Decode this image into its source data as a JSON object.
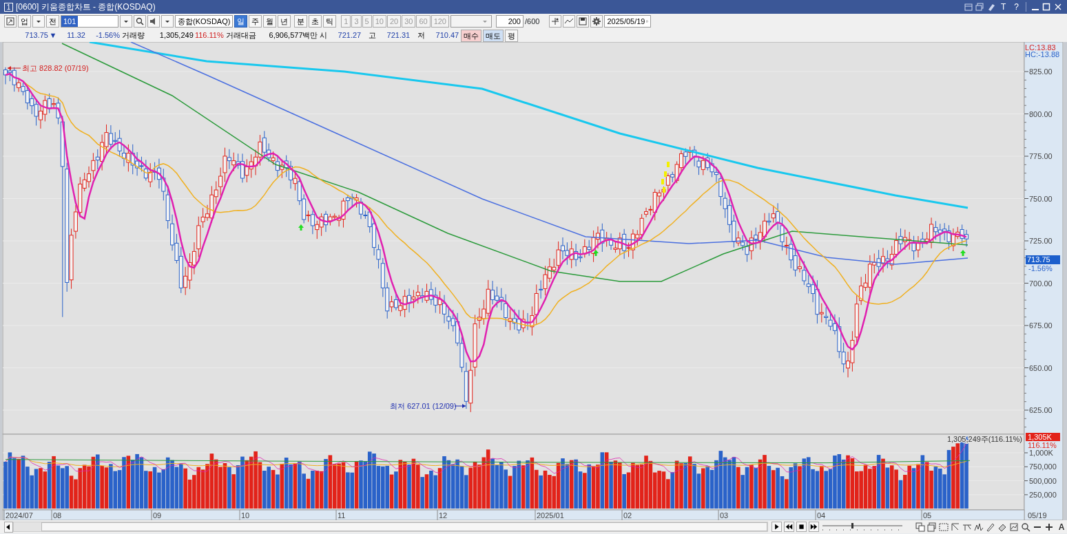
{
  "window": {
    "badge": "1",
    "title": "[0600] 키움종합차트 - 종합(KOSDAQ)",
    "text_buttons": [
      "T",
      "?"
    ]
  },
  "toolbar": {
    "market": "업",
    "scope": "전",
    "code": "101",
    "name": "종합(KOSDAQ)",
    "periods": [
      {
        "label": "일",
        "kind": "date",
        "selected": true
      },
      {
        "label": "주",
        "kind": "date",
        "selected": false
      },
      {
        "label": "월",
        "kind": "date",
        "selected": false
      },
      {
        "label": "년",
        "kind": "date",
        "selected": false
      },
      {
        "label": "분",
        "kind": "time",
        "selected": false
      },
      {
        "label": "초",
        "kind": "time",
        "selected": false
      },
      {
        "label": "틱",
        "kind": "time",
        "selected": false
      }
    ],
    "intervals": [
      {
        "label": "1",
        "disabled": true
      },
      {
        "label": "3",
        "disabled": true
      },
      {
        "label": "5",
        "disabled": true
      },
      {
        "label": "10",
        "disabled": true
      },
      {
        "label": "20",
        "disabled": true
      },
      {
        "label": "30",
        "disabled": true
      },
      {
        "label": "60",
        "disabled": true
      },
      {
        "label": "120",
        "disabled": true
      }
    ],
    "count": "200",
    "count_max": "/600",
    "date": "2025/05/19"
  },
  "quote": {
    "price": "713.75",
    "direction": "▼",
    "change": "11.32",
    "change_pct": "-1.56%",
    "volume_label": "거래량",
    "volume": "1,305,249",
    "volume_ratio": "116.11%",
    "value_label": "거래대금",
    "value": "6,906,577백만",
    "open_label": "시",
    "open": "721.27",
    "high_label": "고",
    "high": "721.31",
    "low_label": "저",
    "low": "710.47",
    "buttons": [
      {
        "label": "매수",
        "kind": "buy"
      },
      {
        "label": "매도",
        "kind": "sell"
      },
      {
        "label": "평",
        "kind": "plain"
      }
    ]
  },
  "price_pane": {
    "lc": "LC:13.83",
    "hc": "HC:-13.88",
    "high_note": "최고 828.82 (07/19)",
    "low_note": "최저 627.01 (12/09)",
    "y_ticks": [
      "825.00",
      "800.00",
      "775.00",
      "750.00",
      "725.00",
      "700.00",
      "675.00",
      "650.00",
      "625.00"
    ],
    "current_price": "713.75",
    "current_change": "-1.56%"
  },
  "volume_pane": {
    "caption": "1,305,249주(116.11%)",
    "current_volume": "1,305K",
    "current_ratio": "116.11%",
    "y_ticks": [
      "1,000K",
      "750,000",
      "500,000",
      "250,000"
    ]
  },
  "x_axis": {
    "labels": [
      "2024/07",
      "08",
      "09",
      "10",
      "11",
      "12",
      "2025/01",
      "02",
      "03",
      "04",
      "05"
    ],
    "last_date": "05/19"
  },
  "bottom_toolbar": {
    "font_button": "A"
  }
}
